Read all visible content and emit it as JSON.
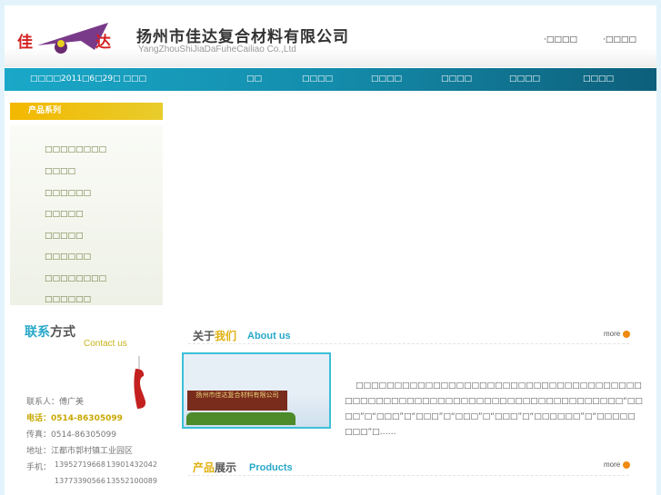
{
  "header": {
    "company_cn": "扬州市佳达复合材料有限公司",
    "company_en": "YangZhouShiJiaDaFuheCailiao Co.,Ltd",
    "logo_text_left": "佳",
    "logo_text_right": "达",
    "links": [
      "·□□□□",
      "·□□□□"
    ]
  },
  "nav": {
    "date": "□□□□2011□6□29□ □□□",
    "items": [
      "□□",
      "□□□□",
      "□□□□",
      "□□□□",
      "□□□□",
      "□□□□"
    ]
  },
  "sidebar": {
    "title": "产品系列",
    "items": [
      "□□□□□□□□",
      "□□□□",
      "□□□□□□",
      "□□□□□",
      "□□□□□",
      "□□□□□□",
      "□□□□□□□□",
      "□□□□□□"
    ]
  },
  "contact": {
    "title_a": "联系",
    "title_b": "方式",
    "title_en": "Contact us",
    "person": "联系人：傅广美",
    "tel": "电话：0514-86305099",
    "fax": "传真：0514-86305099",
    "address": "地址：江都市郭村镇工业园区",
    "mobile_label": "手机：",
    "mobiles": [
      "13952719668",
      "13901432042",
      "13773390566",
      "13552100089"
    ]
  },
  "about": {
    "title_a": "关于",
    "title_b": "我们",
    "title_en": "About us",
    "more": "more",
    "sign": "扬州市佳达复合材料有限公司",
    "text": "□□□□□□□□□□□□□□□□□□□□□□□□□□□□□□□□□□□□□□□□□□□□□□□□□□□□□□□□□□□□□□□□□□□□□□□□□“□□□□”□“□□□”□“□□□”□“□□□”□“□□□”□“□□□□□□”□“□□□□□□□□”□……"
  },
  "products": {
    "title_a": "产品",
    "title_b": "展示",
    "title_en": "Products",
    "more": "more"
  }
}
